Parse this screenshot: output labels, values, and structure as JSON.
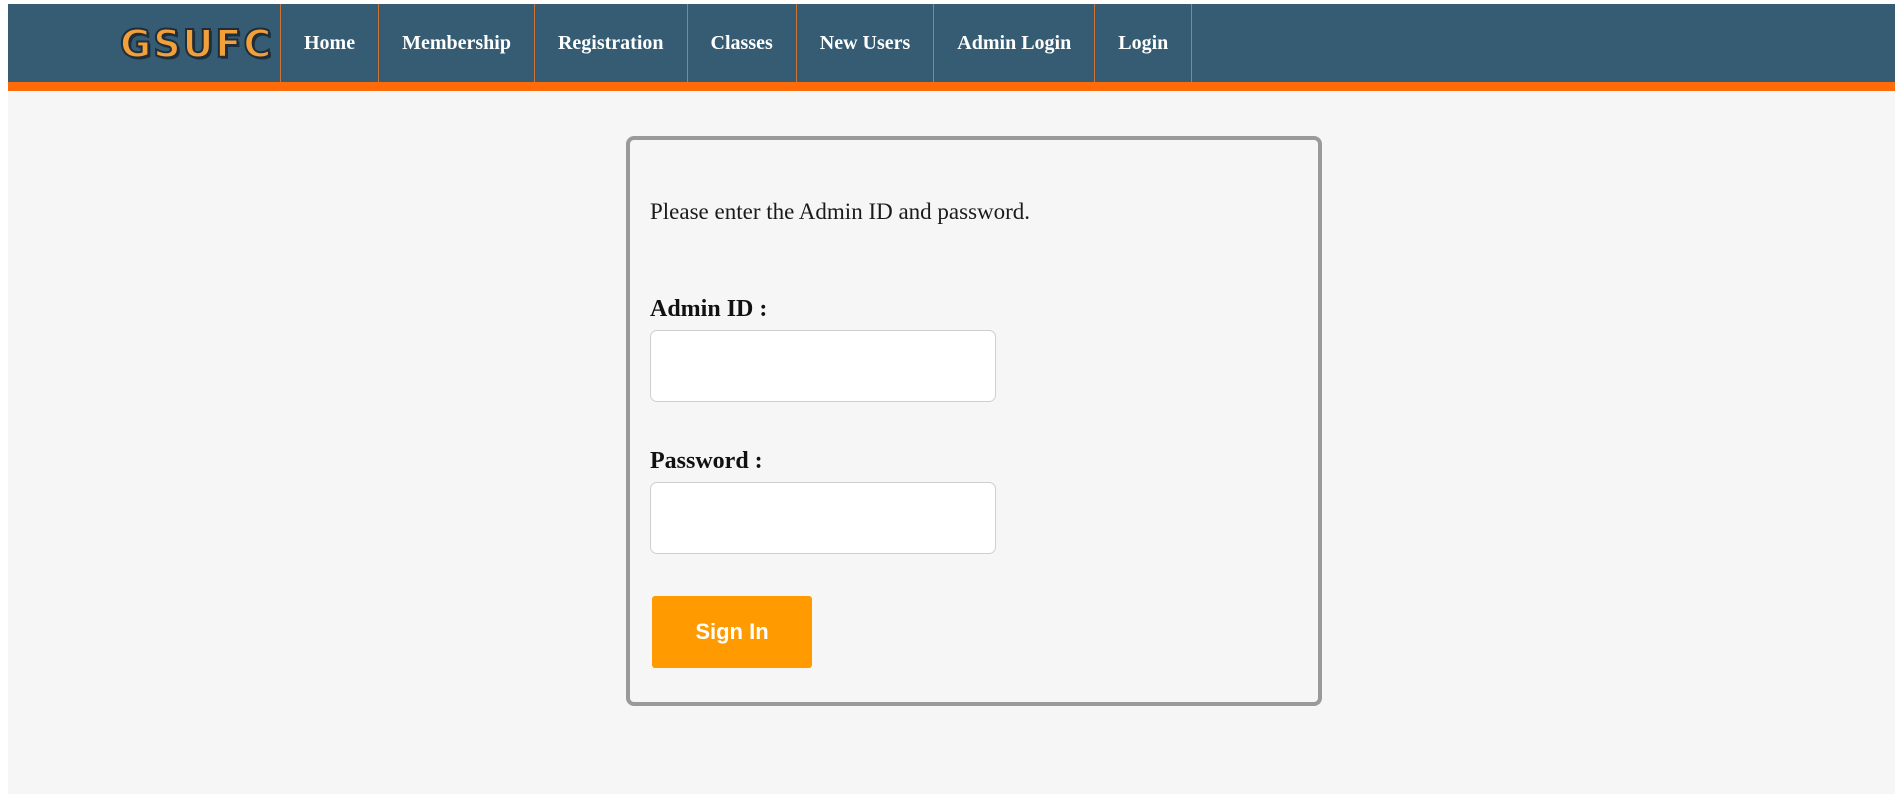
{
  "brand": {
    "logo_text": "GSUFC"
  },
  "nav": {
    "items": [
      {
        "label": "Home"
      },
      {
        "label": "Membership"
      },
      {
        "label": "Registration"
      },
      {
        "label": "Classes"
      },
      {
        "label": "New Users"
      },
      {
        "label": "Admin Login"
      },
      {
        "label": "Login"
      }
    ]
  },
  "login_form": {
    "instructions": "Please enter the Admin ID and password.",
    "admin_id_label": "Admin ID :",
    "admin_id_value": "",
    "password_label": "Password :",
    "password_value": "",
    "submit_label": "Sign In"
  },
  "colors": {
    "navbar_background": "#355c72",
    "navbar_accent": "#ff6b08",
    "button_background": "#ff9b00",
    "page_background": "#f6f6f6"
  }
}
